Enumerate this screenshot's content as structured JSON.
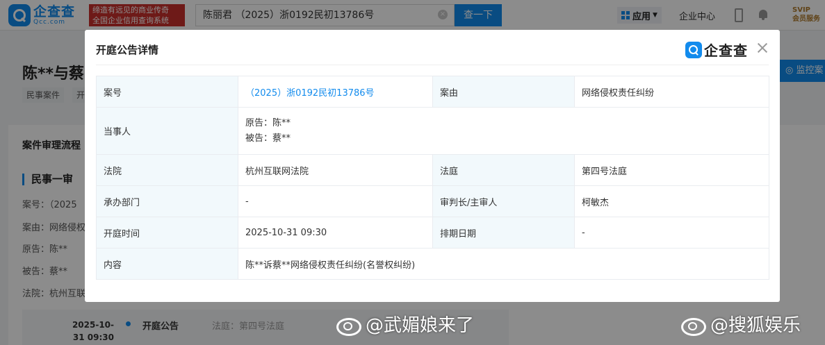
{
  "topbar": {
    "logo_cn": "企查查",
    "logo_en": "Qcc.com",
    "slogan_line1": "缔造有远见的商业传奇",
    "slogan_line2": "全国企业信用查询系统",
    "search_value": "陈丽君 （2025）浙0192民初13786号",
    "search_button": "查一下",
    "app_menu": "应用",
    "enterprise_center": "企业中心",
    "svip_line1": "SVIP",
    "svip_line2": "会员服务"
  },
  "background": {
    "title": "陈**与蔡",
    "tags": [
      "民事案件",
      "开"
    ],
    "monitor_button": "监控案",
    "section_title": "案件审理流程",
    "subhead": "民事一审",
    "lines": [
      "案号：（2025",
      "案由：网络侵权",
      "原告：陈**",
      "被告：蔡**",
      "法院：杭州互联"
    ],
    "timeline": {
      "date": "2025-10-31 09:30",
      "title": "开庭公告",
      "court": "法庭：第四号法庭"
    }
  },
  "modal": {
    "title": "开庭公告详情",
    "logo_text": "企查查",
    "rows": {
      "case_no_label": "案号",
      "case_no": "（2025）浙0192民初13786号",
      "cause_label": "案由",
      "cause": "网络侵权责任纠纷",
      "parties_label": "当事人",
      "plaintiff": "原告：陈**",
      "defendant": "被告：蔡**",
      "court_label": "法院",
      "court": "杭州互联网法院",
      "tribunal_label": "法庭",
      "tribunal": "第四号法庭",
      "department_label": "承办部门",
      "department": "-",
      "judge_label": "审判长/主审人",
      "judge": "柯敏杰",
      "hearing_time_label": "开庭时间",
      "hearing_time": "2025-10-31 09:30",
      "schedule_date_label": "排期日期",
      "schedule_date": "-",
      "content_label": "内容",
      "content": "陈**诉蔡**网络侵权责任纠纷(名誉权纠纷)"
    }
  },
  "watermarks": {
    "left": "@武媚娘来了",
    "right": "@搜狐娱乐"
  },
  "colors": {
    "brand_blue": "#128bed",
    "slogan_red": "#c9302c",
    "label_bg": "#f2f9fc"
  }
}
